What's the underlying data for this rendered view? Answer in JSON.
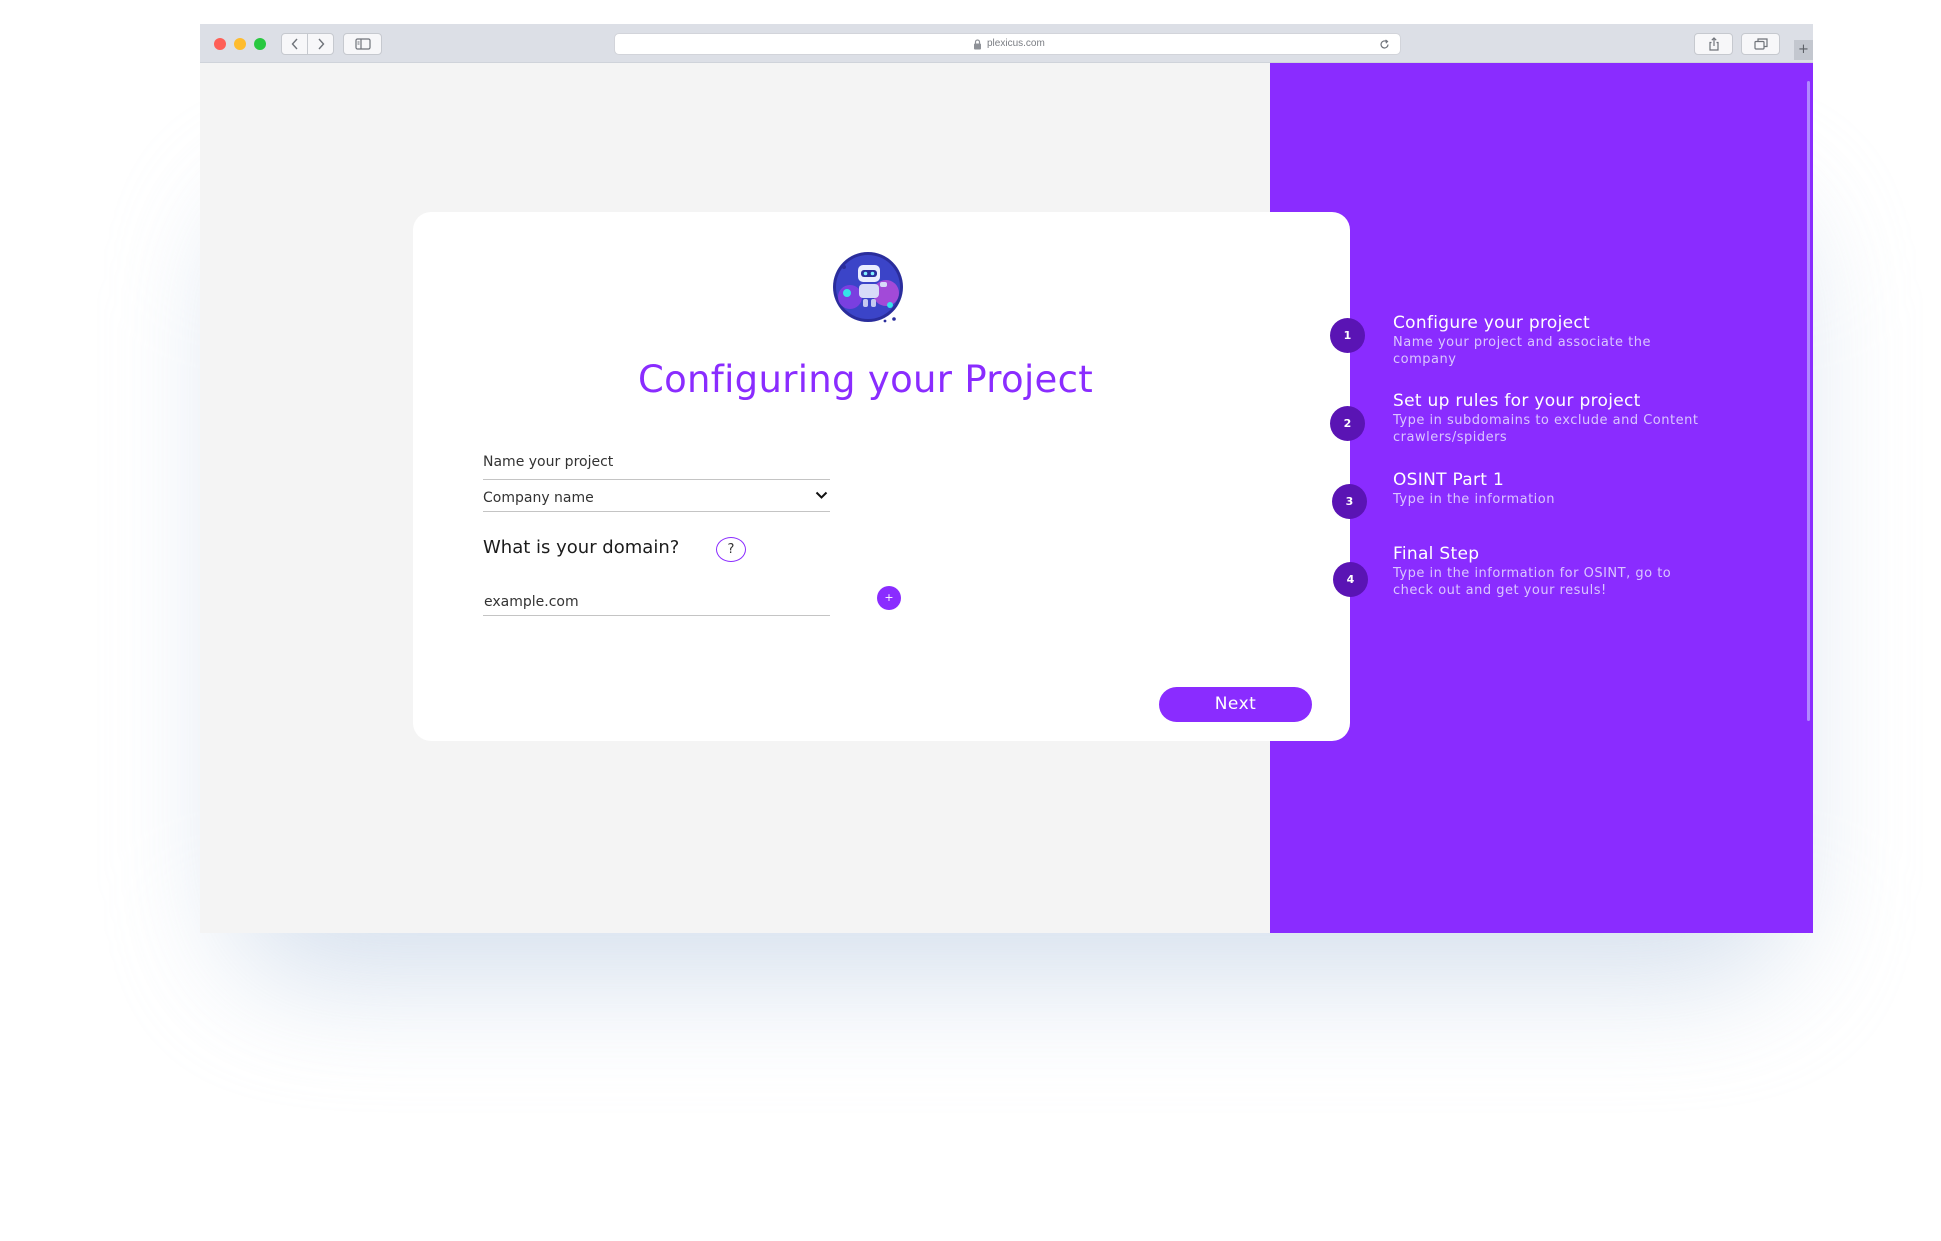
{
  "browser": {
    "address": "plexicus.com",
    "new_tab_glyph": "+"
  },
  "card": {
    "title": "Configuring your Project",
    "project_name_placeholder": "Name your project",
    "company_select_value": "Company name",
    "domain_question": "What is your domain?",
    "help_glyph": "?",
    "domain_placeholder": "example.com",
    "add_glyph": "+",
    "next_label": "Next"
  },
  "steps": [
    {
      "number": "1",
      "title": "Configure your project",
      "description": "Name your project and associate the company"
    },
    {
      "number": "2",
      "title": "Set up rules for your project",
      "description": "Type in subdomains to exclude and Content crawlers/spiders"
    },
    {
      "number": "3",
      "title": "OSINT Part 1",
      "description": "Type in the information"
    },
    {
      "number": "4",
      "title": "Final Step",
      "description": "Type in the information for OSINT, go to check out and get your resuls!"
    }
  ],
  "colors": {
    "accent": "#8a2cff",
    "step_circle": "#5a14b4",
    "page_background": "#f4f4f4"
  }
}
